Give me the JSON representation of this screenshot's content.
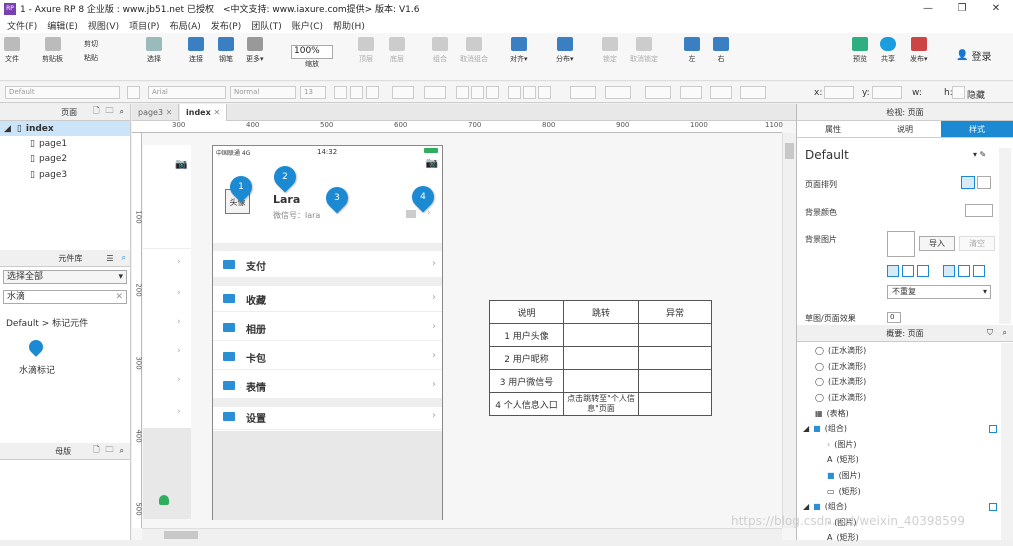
{
  "window": {
    "title": "1 - Axure RP 8 企业版 : www.jb51.net 已授权　<中文支持: www.iaxure.com提供> 版本: V1.6",
    "logo": "RP"
  },
  "menu": [
    "文件(F)",
    "编辑(E)",
    "视图(V)",
    "项目(P)",
    "布局(A)",
    "发布(P)",
    "团队(T)",
    "账户(C)",
    "帮助(H)"
  ],
  "toolbar": {
    "file": "文件",
    "clipboard": "剪贴板",
    "cut": "剪切",
    "copy": "复制",
    "paste": "粘贴",
    "select": "选择",
    "connect": "连接",
    "pen": "钢笔",
    "more": "更多▾",
    "zoom": "100%",
    "zoom_label": "缩放",
    "top": "顶层",
    "bottom": "底层",
    "group": "组合",
    "ungroup": "取消组合",
    "align": "对齐▾",
    "distribute": "分布▾",
    "lock": "锁定",
    "unlock": "取消锁定",
    "left": "左",
    "right": "右",
    "preview": "预览",
    "share": "共享",
    "publish": "发布▾",
    "login": "登录"
  },
  "format": {
    "style": "Default",
    "font": "Arial",
    "weight": "Normal",
    "size": "13",
    "x": "x:",
    "y": "y:",
    "w": "w:",
    "h": "h:",
    "hide": "隐藏"
  },
  "left": {
    "pages_title": "页面",
    "pages": [
      "index",
      "page1",
      "page2",
      "page3"
    ],
    "lib_title": "元件库",
    "lib_select": "选择全部",
    "lib_search": "水滴",
    "lib_group": "Default > 标记元件",
    "lib_item": "水滴标记",
    "master_title": "母版"
  },
  "tabs": [
    "page3",
    "index"
  ],
  "ruler": {
    "h": [
      "300",
      "400",
      "500",
      "600",
      "700",
      "800",
      "900",
      "1000",
      "1100"
    ],
    "v": [
      "100",
      "200",
      "300",
      "400",
      "500"
    ]
  },
  "phone": {
    "carrier": "中国联通 4G",
    "time": "14:32",
    "avatar": "头像",
    "name": "Lara",
    "wechat": "微信号：lara",
    "items": [
      "支付",
      "收藏",
      "相册",
      "卡包",
      "表情",
      "设置"
    ]
  },
  "markers": [
    "1",
    "2",
    "3",
    "4"
  ],
  "table": {
    "headers": [
      "说明",
      "跳转",
      "异常"
    ],
    "rows": [
      [
        "1 用户头像",
        "",
        ""
      ],
      [
        "2 用户昵称",
        "",
        ""
      ],
      [
        "3 用户微信号",
        "",
        ""
      ],
      [
        "4 个人信息入口",
        "点击跳转至\"个人信息\"页面",
        ""
      ]
    ]
  },
  "right": {
    "title": "检视: 页面",
    "tabs": [
      "属性",
      "说明",
      "样式"
    ],
    "style_name": "Default",
    "layout": "页面排列",
    "bg_color": "背景颜色",
    "bg_image": "背景图片",
    "import": "导入",
    "clear": "清空",
    "repeat": "不重复",
    "sketch": "草图/页面效果",
    "sketch_val": "0",
    "outline_title": "概要: 页面",
    "outline": [
      "(正水滴形)",
      "(正水滴形)",
      "(正水滴形)",
      "(正水滴形)",
      "(表格)",
      "(组合)",
      "(图片)",
      "(矩形)",
      "(图片)",
      "(矩形)",
      "(组合)",
      "(图片)",
      "(矩形)"
    ]
  },
  "watermark": "https://blog.csdn.net/weixin_40398599"
}
